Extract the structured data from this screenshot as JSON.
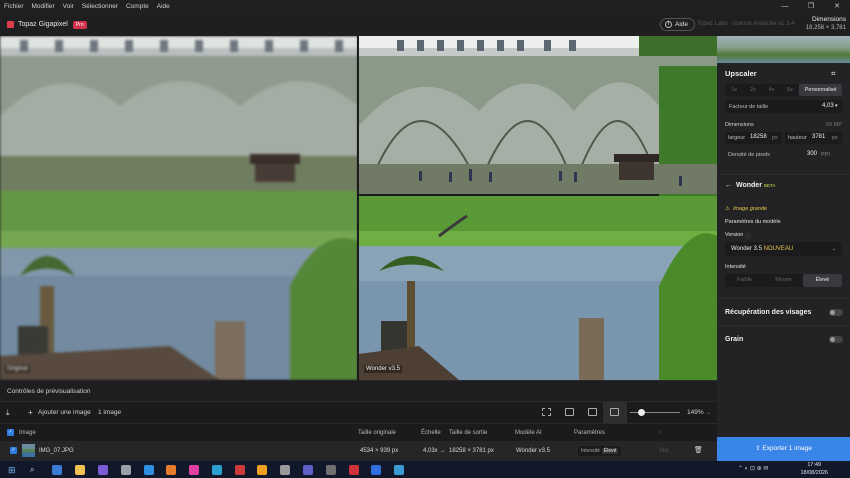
{
  "menu": [
    "Fichier",
    "Modifier",
    "Voir",
    "Sélectionner",
    "Compte",
    "Aide"
  ],
  "app": {
    "name": "Topaz Gigapixel",
    "badge": "Pro",
    "help_label": "Aide",
    "licence": "Topaz Labs · licence Avancée",
    "version": "v1.3.4",
    "dimensions_label": "Dimensions",
    "dimensions_value": "18,258 × 3,781"
  },
  "preview": {
    "left_label": "Original",
    "right_label": "Wonder v3.5"
  },
  "controls_label": "Contrôles de prévisualisation",
  "toolbar": {
    "add_label": "Ajouter une image",
    "count_label": "1 image",
    "zoom": "149%"
  },
  "table": {
    "headers": {
      "image": "Image",
      "original_size": "Taille originale",
      "scale": "Échelle",
      "output_size": "Taille de sortie",
      "model": "Modèle AI",
      "params": "Paramètres"
    },
    "row": {
      "filename": "IMG_07.JPG",
      "original_size": "4534 × 939 px",
      "scale": "4,03x →",
      "output_size": "18258 × 3781 px",
      "model": "Wonder v3.5",
      "param_name": "Intensité",
      "param_value": "Élevé",
      "extra": "Niv."
    }
  },
  "panel": {
    "upscaler_title": "Upscaler",
    "scale_options": [
      "1x",
      "2x",
      "4x",
      "6x",
      "Personnalisé"
    ],
    "scale_selected": "Personnalisé",
    "factor_label": "Facteur de taille",
    "factor_value": "4,03",
    "dimensions_label": "Dimensions",
    "megapixels": "69 MP",
    "width_label": "largeur",
    "width_value": "18258",
    "width_unit": "px",
    "height_label": "hauteur",
    "height_value": "3781",
    "height_unit": "px",
    "density_label": "Densité de pixels",
    "density_value": "300",
    "density_unit": "PPI",
    "model_title": "Wonder",
    "model_badge": "BETA",
    "warning": "Image grande",
    "model_params_label": "Paramètres du modèle",
    "version_label": "Version",
    "version_value": "Wonder 3.5",
    "version_new": "NOUVEAU",
    "intensity_label": "Intensité",
    "intensity_options": [
      "Faible",
      "Moyen",
      "Élevé"
    ],
    "intensity_selected": "Élevé",
    "face_recovery": "Récupération des visages",
    "grain": "Grain",
    "export_label": "Exporter 1 image"
  },
  "taskbar": {
    "time": "17:49",
    "date": "18/08/2026",
    "apps": [
      "#3a7bd5",
      "#f2c14e",
      "#7b5bd6",
      "#9aa0a6",
      "#2f8fe0",
      "#e57d2b",
      "#e040a0",
      "#2aa0d0",
      "#cc3b3b",
      "#f0a020",
      "#9a9a9a",
      "#5b5fc7",
      "#707070",
      "#d0303a",
      "#2f6fe0",
      "#3a9bd5"
    ]
  },
  "colors": {
    "accent": "#3a86e8",
    "new_badge": "#e6c74b",
    "brand": "#e03d4a"
  }
}
